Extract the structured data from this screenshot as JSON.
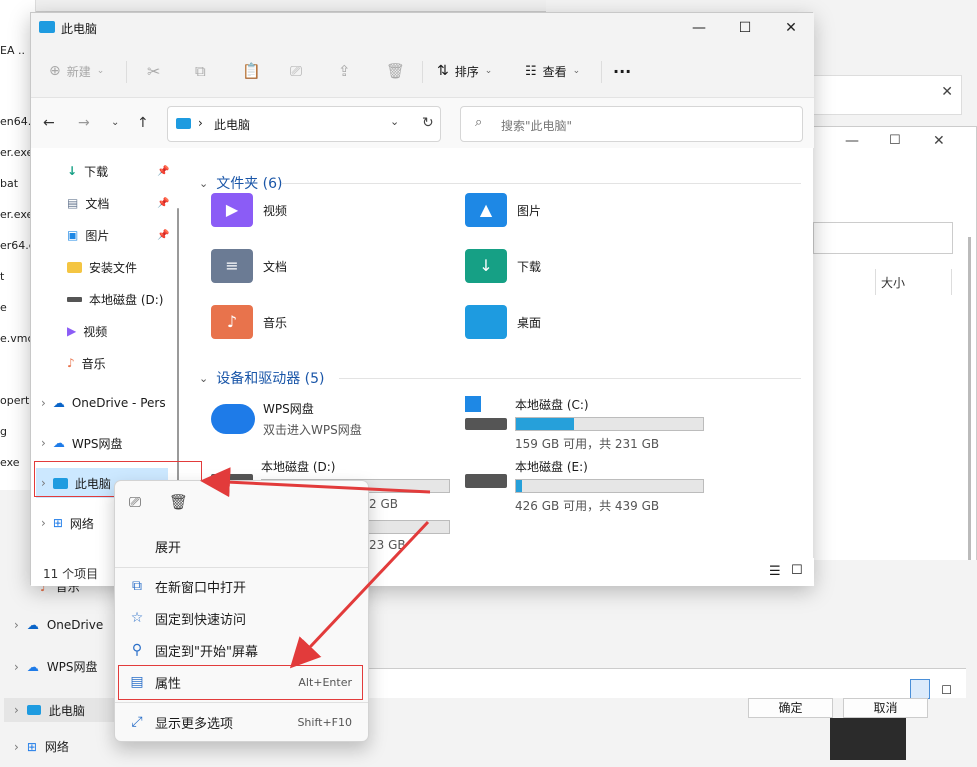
{
  "background": {
    "left_strip_texts": [
      "EA ..",
      "en64.",
      "er.exe",
      "bat",
      "er.exe",
      "er64.e",
      "t",
      "e",
      "e.vmc",
      "opert",
      "g",
      "exe"
    ],
    "nav2": [
      {
        "label": "音乐",
        "icon": "music-icon"
      },
      {
        "label": "OneDrive",
        "icon": "cloud-icon"
      },
      {
        "label": "WPS网盘",
        "icon": "cloud-icon"
      },
      {
        "label": "此电脑",
        "icon": "computer-icon"
      },
      {
        "label": "网络",
        "icon": "network-icon"
      }
    ],
    "size_col": "大小",
    "ok_btn": "确定",
    "cancel_btn": "取消"
  },
  "window": {
    "title": "此电脑",
    "toolbar": {
      "new": "新建",
      "sort": "排序",
      "view": "查看",
      "more": "···"
    },
    "address": {
      "crumb": "此电脑"
    },
    "search": {
      "placeholder": "搜索\"此电脑\""
    },
    "nav": [
      {
        "label": "下载",
        "icon": "download-icon",
        "pinned": true
      },
      {
        "label": "文档",
        "icon": "document-icon",
        "pinned": true
      },
      {
        "label": "图片",
        "icon": "picture-icon",
        "pinned": true
      },
      {
        "label": "安装文件",
        "icon": "folder-icon"
      },
      {
        "label": "本地磁盘 (D:)",
        "icon": "drive-icon"
      },
      {
        "label": "视频",
        "icon": "video-icon"
      },
      {
        "label": "音乐",
        "icon": "music-icon"
      },
      {
        "label": "OneDrive - Pers",
        "icon": "cloud-icon"
      },
      {
        "label": "WPS网盘",
        "icon": "cloud-icon"
      },
      {
        "label": "此电脑",
        "icon": "computer-icon"
      },
      {
        "label": "网络",
        "icon": "network-icon"
      }
    ],
    "folders_header": "文件夹 (6)",
    "folders": [
      {
        "label": "视频",
        "icon": "video-folder-icon",
        "color": "#8b5cf6"
      },
      {
        "label": "图片",
        "icon": "picture-folder-icon",
        "color": "#1e88e5"
      },
      {
        "label": "文档",
        "icon": "document-folder-icon",
        "color": "#6b7b94"
      },
      {
        "label": "下载",
        "icon": "download-folder-icon",
        "color": "#16a085"
      },
      {
        "label": "音乐",
        "icon": "music-folder-icon",
        "color": "#e8734c"
      },
      {
        "label": "桌面",
        "icon": "desktop-folder-icon",
        "color": "#1e9be0"
      }
    ],
    "devices_header": "设备和驱动器 (5)",
    "devices": [
      {
        "name": "WPS网盘",
        "sub": "双击进入WPS网盘",
        "icon": "wps-cloud-icon"
      },
      {
        "name": "本地磁盘 (C:)",
        "free": "159 GB 可用，共 231 GB",
        "used_fraction": 0.31,
        "icon": "windows-drive-icon"
      },
      {
        "name": "本地磁盘 (D:)",
        "free": "2 GB",
        "used_fraction": 0.07,
        "icon": "drive-icon"
      },
      {
        "name": "本地磁盘 (E:)",
        "free": "426 GB 可用，共 439 GB",
        "used_fraction": 0.03,
        "icon": "drive-icon"
      },
      {
        "name": "",
        "free": "23 GB",
        "used_fraction": 0.0,
        "icon": "drive-icon"
      }
    ],
    "status": "11 个项目"
  },
  "context_menu": {
    "expand": "展开",
    "items": [
      {
        "label": "在新窗口中打开",
        "icon": "open-window-icon",
        "shortcut": ""
      },
      {
        "label": "固定到快速访问",
        "icon": "star-icon",
        "shortcut": ""
      },
      {
        "label": "固定到\"开始\"屏幕",
        "icon": "pin-icon",
        "shortcut": ""
      },
      {
        "label": "属性",
        "icon": "properties-icon",
        "shortcut": "Alt+Enter"
      },
      {
        "label": "显示更多选项",
        "icon": "more-options-icon",
        "shortcut": "Shift+F10"
      }
    ]
  },
  "colors": {
    "accent": "#0067c0",
    "annotation": "#e23b3b",
    "drive_bar": "#26a0da"
  }
}
